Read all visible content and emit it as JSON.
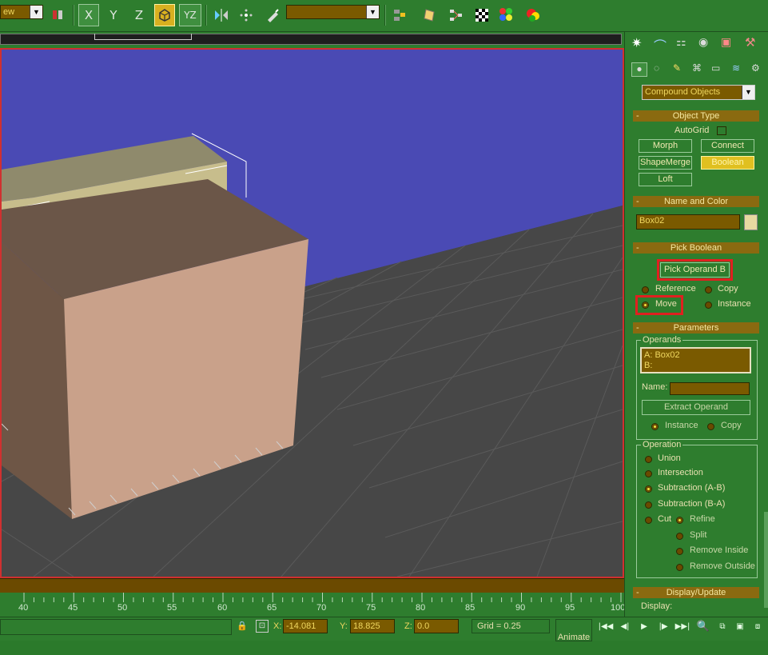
{
  "toolbar": {
    "view_dropdown": "ew",
    "axis_x": "X",
    "axis_y": "Y",
    "axis_z": "Z",
    "axis_yz": "YZ",
    "named_selection": ""
  },
  "command_panel": {
    "category_dropdown": "Compound Objects",
    "object_type": {
      "header": "Object Type",
      "autogrid": "AutoGrid",
      "buttons": [
        "Morph",
        "Connect",
        "ShapeMerge",
        "Boolean",
        "Loft"
      ]
    },
    "name_and_color": {
      "header": "Name and Color",
      "name": "Box02",
      "color": "#e6d9a0"
    },
    "pick_boolean": {
      "header": "Pick Boolean",
      "pick_button": "Pick Operand B",
      "reference": "Reference",
      "copy": "Copy",
      "move": "Move",
      "instance": "Instance"
    },
    "parameters": {
      "header": "Parameters",
      "operands_label": "Operands",
      "operand_a": "A: Box02",
      "operand_b": "B:",
      "name_label": "Name:",
      "name_value": "",
      "extract_button": "Extract Operand",
      "instance": "Instance",
      "copy": "Copy",
      "operation_label": "Operation",
      "union": "Union",
      "intersection": "Intersection",
      "subtraction_ab": "Subtraction (A-B)",
      "subtraction_ba": "Subtraction (B-A)",
      "cut": "Cut",
      "refine": "Refine",
      "split": "Split",
      "remove_inside": "Remove Inside",
      "remove_outside": "Remove Outside"
    },
    "display_update": {
      "header": "Display/Update",
      "display_label": "Display:"
    }
  },
  "timeline": {
    "ticks": [
      "40",
      "45",
      "50",
      "55",
      "60",
      "65",
      "70",
      "75",
      "80",
      "85",
      "90",
      "95",
      "100"
    ]
  },
  "status": {
    "x_label": "X:",
    "x_value": "-14.081",
    "y_label": "Y:",
    "y_value": "18.825",
    "z_label": "Z:",
    "z_value": "0.0",
    "grid": "Grid = 0.25",
    "animate": "Animate"
  },
  "colors": {
    "ui_green": "#2e7d2e",
    "viewport_sky": "#4a4ab4",
    "floor": "#464646",
    "field_brown": "#7a5a00",
    "highlight_red": "#e02020"
  }
}
